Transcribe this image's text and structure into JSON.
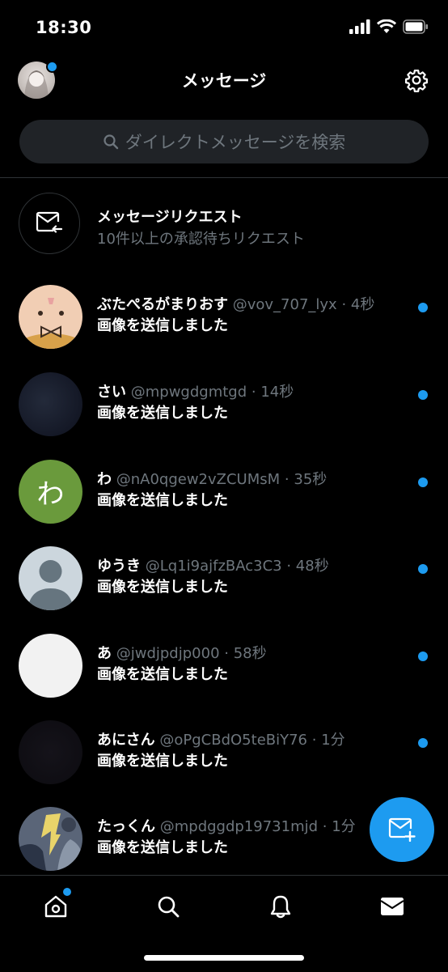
{
  "status_bar": {
    "time": "18:30"
  },
  "header": {
    "title": "メッセージ"
  },
  "search": {
    "placeholder": "ダイレクトメッセージを検索"
  },
  "requests": {
    "title": "メッセージリクエスト",
    "subtitle": "10件以上の承認待ちリクエスト"
  },
  "conversations": [
    {
      "name": "ぶたぺるがまりおす",
      "handle": "@vov_707_lyx",
      "time": "· 4秒",
      "preview": "画像を送信しました",
      "unread": true
    },
    {
      "name": "さい",
      "handle": "@mpwgdgmtgd",
      "time": "· 14秒",
      "preview": "画像を送信しました",
      "unread": true
    },
    {
      "name": "わ",
      "handle": "@nA0qgew2vZCUMsM",
      "time": "· 35秒",
      "preview": "画像を送信しました",
      "unread": true,
      "avatar_letter": "わ"
    },
    {
      "name": "ゆうき",
      "handle": "@Lq1i9ajfzBAc3C3",
      "time": "· 48秒",
      "preview": "画像を送信しました",
      "unread": true
    },
    {
      "name": "あ",
      "handle": "@jwdjpdjp000",
      "time": "· 58秒",
      "preview": "画像を送信しました",
      "unread": true
    },
    {
      "name": "あにさん",
      "handle": "@oPgCBdO5teBiY76",
      "time": "· 1分",
      "preview": "画像を送信しました",
      "unread": true
    },
    {
      "name": "たっくん",
      "handle": "@mpdggdp19731mjd",
      "time": "· 1分",
      "preview": "画像を送信しました",
      "unread": false
    }
  ],
  "colors": {
    "accent": "#1d9bf0",
    "background": "#000000",
    "muted": "#6e767d"
  },
  "icons": {
    "settings": "gear-icon",
    "search": "search-icon",
    "new_message": "compose-message-icon"
  }
}
